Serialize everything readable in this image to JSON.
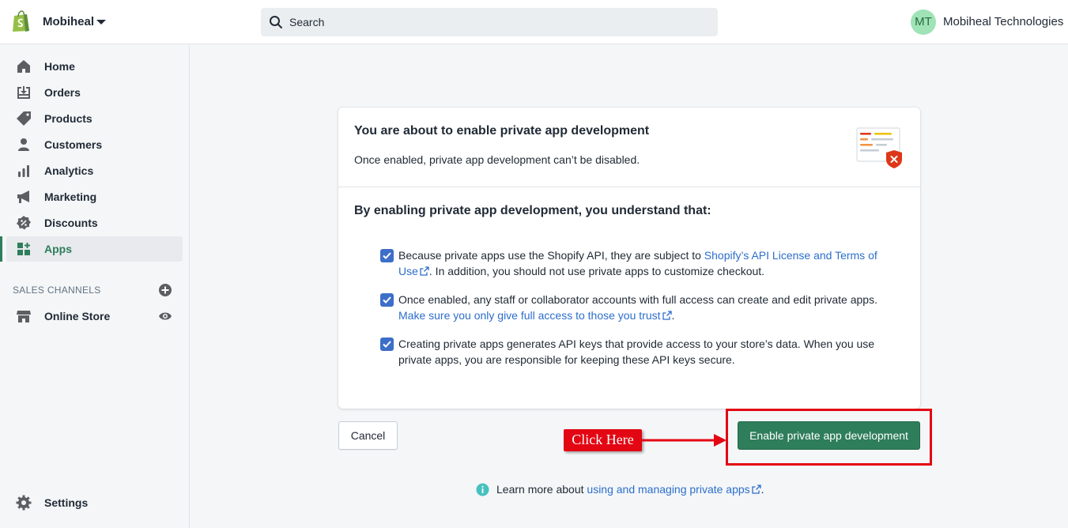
{
  "topbar": {
    "store_name": "Mobiheal",
    "store_logo_icon": "shopify-bag-icon",
    "search_placeholder": "Search",
    "avatar_initials": "MT",
    "user_name": "Mobiheal Technologies"
  },
  "sidebar": {
    "items": [
      {
        "label": "Home",
        "icon": "home-icon"
      },
      {
        "label": "Orders",
        "icon": "orders-icon"
      },
      {
        "label": "Products",
        "icon": "tag-icon"
      },
      {
        "label": "Customers",
        "icon": "person-icon"
      },
      {
        "label": "Analytics",
        "icon": "bar-chart-icon"
      },
      {
        "label": "Marketing",
        "icon": "megaphone-icon"
      },
      {
        "label": "Discounts",
        "icon": "discount-icon"
      },
      {
        "label": "Apps",
        "icon": "apps-icon",
        "active": true
      }
    ],
    "sales_channels_title": "SALES CHANNELS",
    "online_store_label": "Online Store",
    "settings_label": "Settings"
  },
  "card": {
    "title": "You are about to enable private app development",
    "subtitle": "Once enabled, private app development can’t be disabled.",
    "section_heading": "By enabling private app development, you understand that:",
    "items": [
      {
        "text_before": "Because private apps use the Shopify API, they are subject to ",
        "link": "Shopify’s API License and Terms of Use",
        "text_after": ". In addition, you should not use private apps to customize checkout.",
        "checked": true
      },
      {
        "text_before": "Once enabled, any staff or collaborator accounts with full access can create and edit private apps. ",
        "link": "Make sure you only give full access to those you trust",
        "text_after": ".",
        "checked": true
      },
      {
        "text_before": "Creating private apps generates API keys that provide access to your store’s data. When you use private apps, you are responsible for keeping these API keys secure.",
        "link": "",
        "text_after": "",
        "checked": true
      }
    ]
  },
  "actions": {
    "cancel_label": "Cancel",
    "enable_label": "Enable private app development",
    "annotation_label": "Click Here"
  },
  "footer": {
    "text": "Learn more about ",
    "link": "using and managing private apps",
    "after": "."
  },
  "colors": {
    "primary": "#2e7d5b",
    "link": "#2c6ecb",
    "annotation": "#e30613",
    "checkbox": "#3d6ec9"
  }
}
